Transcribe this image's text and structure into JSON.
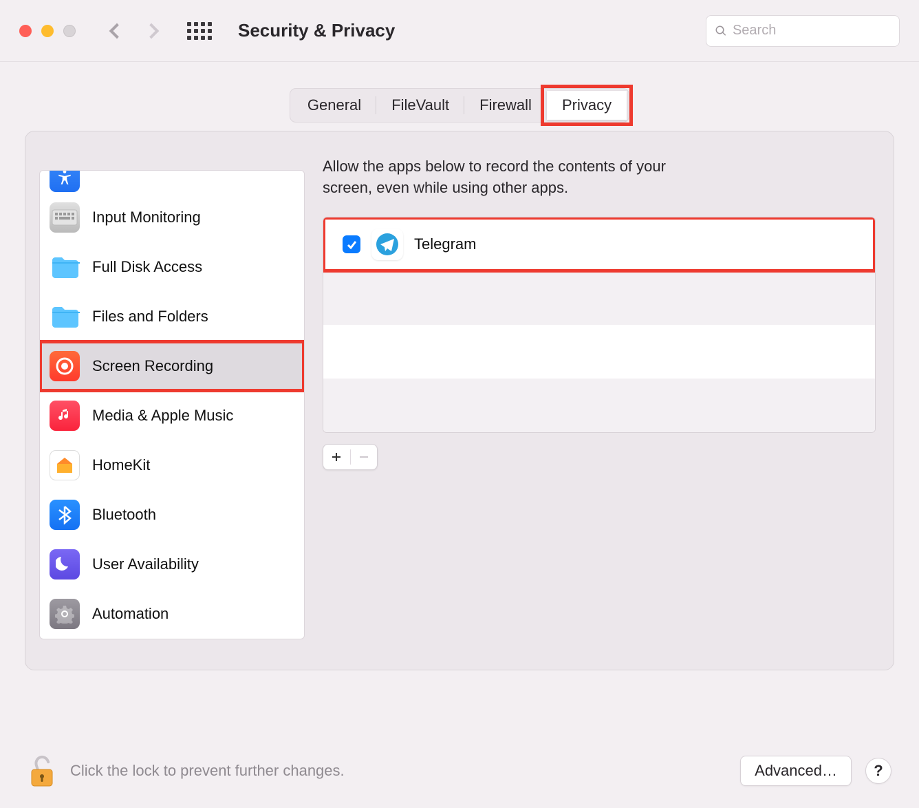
{
  "window": {
    "title": "Security & Privacy"
  },
  "search": {
    "placeholder": "Search",
    "value": ""
  },
  "tabs": {
    "general": "General",
    "filevault": "FileVault",
    "firewall": "Firewall",
    "privacy": "Privacy",
    "active": "privacy"
  },
  "sidebar": {
    "items": [
      {
        "id": "accessibility",
        "label": ""
      },
      {
        "id": "input-monitoring",
        "label": "Input Monitoring"
      },
      {
        "id": "full-disk-access",
        "label": "Full Disk Access"
      },
      {
        "id": "files-and-folders",
        "label": "Files and Folders"
      },
      {
        "id": "screen-recording",
        "label": "Screen Recording"
      },
      {
        "id": "media-apple-music",
        "label": "Media & Apple Music"
      },
      {
        "id": "homekit",
        "label": "HomeKit"
      },
      {
        "id": "bluetooth",
        "label": "Bluetooth"
      },
      {
        "id": "user-availability",
        "label": "User Availability"
      },
      {
        "id": "automation",
        "label": "Automation"
      }
    ],
    "selected": "screen-recording"
  },
  "detail": {
    "description": "Allow the apps below to record the contents of your screen, even while using other apps.",
    "apps": [
      {
        "name": "Telegram",
        "checked": true
      }
    ]
  },
  "footer": {
    "lock_text": "Click the lock to prevent further changes.",
    "advanced": "Advanced…",
    "help": "?",
    "unlocked": true
  },
  "highlights": {
    "privacy_tab": true,
    "screen_recording_item": true,
    "telegram_row": true
  },
  "colors": {
    "highlight": "#ee3a2f",
    "accent_blue": "#0a7bff"
  }
}
